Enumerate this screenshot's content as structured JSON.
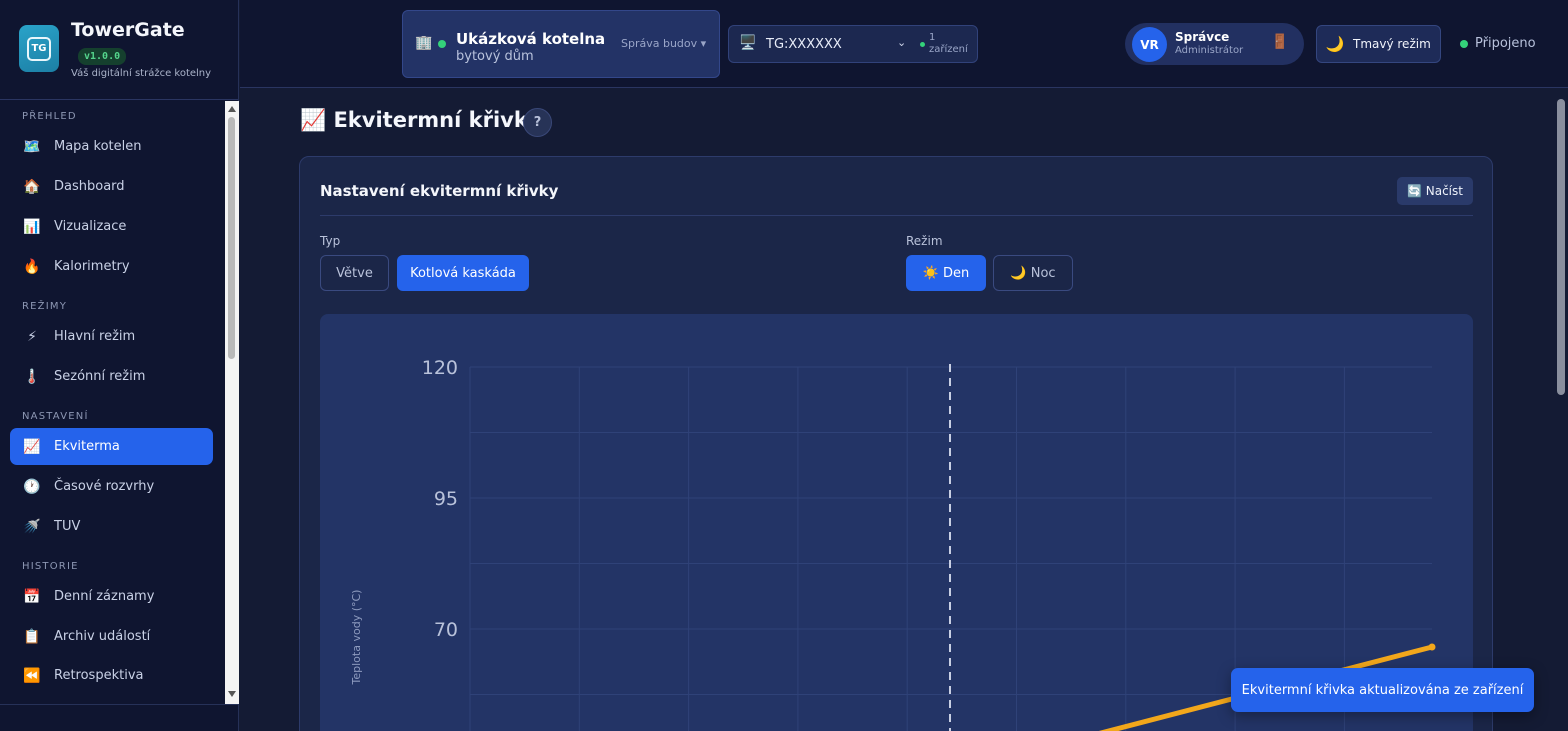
{
  "brand": {
    "name": "TowerGate",
    "version": "v1.0.0",
    "tagline": "Váš digitální strážce kotelny",
    "logo_text": "TG"
  },
  "sidebar": {
    "sections": [
      {
        "label": "PŘEHLED"
      },
      {
        "label": "REŽIMY"
      },
      {
        "label": "NASTAVENÍ"
      },
      {
        "label": "HISTORIE"
      }
    ],
    "items": [
      {
        "label": "Mapa kotelen",
        "icon": "🗺️"
      },
      {
        "label": "Dashboard",
        "icon": "🏠"
      },
      {
        "label": "Vizualizace",
        "icon": "📊"
      },
      {
        "label": "Kalorimetry",
        "icon": "🔥"
      },
      {
        "label": "Hlavní režim",
        "icon": "⚡"
      },
      {
        "label": "Sezónní režim",
        "icon": "🌡️"
      },
      {
        "label": "Ekviterma",
        "icon": "📈",
        "active": true
      },
      {
        "label": "Časové rozvrhy",
        "icon": "🕐"
      },
      {
        "label": "TUV",
        "icon": "🚿"
      },
      {
        "label": "Denní záznamy",
        "icon": "📅"
      },
      {
        "label": "Archiv událostí",
        "icon": "📋"
      },
      {
        "label": "Retrospektiva",
        "icon": "⏪"
      }
    ]
  },
  "topbar": {
    "site": {
      "name": "Ukázková kotelna",
      "type": "bytový dům",
      "management_label": "Správa budov ▾",
      "icon": "🏢",
      "status_color": "#34d27a"
    },
    "device": {
      "id": "TG:XXXXXX",
      "count_label": "1 zařízení",
      "icon": "🖥️"
    },
    "user": {
      "initials": "VR",
      "name": "Správce",
      "role": "Administrátor",
      "logout_icon": "🚪"
    },
    "theme_button": {
      "label": "Tmavý režim",
      "icon": "🌙"
    },
    "connection": {
      "label": "Připojeno",
      "color": "#34d27a"
    }
  },
  "page": {
    "title": "📈 Ekvitermní křivky",
    "help_label": "?"
  },
  "card": {
    "title": "Nastavení ekvitermní křivky",
    "load_label": "🔄 Načíst",
    "type_label": "Typ",
    "type_options": [
      {
        "label": "Větve",
        "selected": false
      },
      {
        "label": "Kotlová kaskáda",
        "selected": true
      }
    ],
    "mode_label": "Režim",
    "mode_options": [
      {
        "label": "☀️ Den",
        "selected": true
      },
      {
        "label": "🌙 Noc",
        "selected": false
      }
    ]
  },
  "chart_data": {
    "type": "line",
    "ylabel": "Teplota vody (°C)",
    "y_ticks_visible": [
      120,
      95,
      70
    ],
    "series": [
      {
        "color": "#f2a71b",
        "points_partial": [
          {
            "x": "",
            "y": null
          }
        ]
      }
    ],
    "reference_line": {
      "style": "dashed",
      "color": "#c8cfe3"
    },
    "grid": true
  },
  "toast": {
    "message": "Ekvitermní křivka aktualizována ze zařízení"
  },
  "colors": {
    "accent": "#2563eb",
    "background": "#141b34",
    "sidebar": "#0f1530",
    "card": "#1b2648",
    "curve": "#f2a71b"
  }
}
